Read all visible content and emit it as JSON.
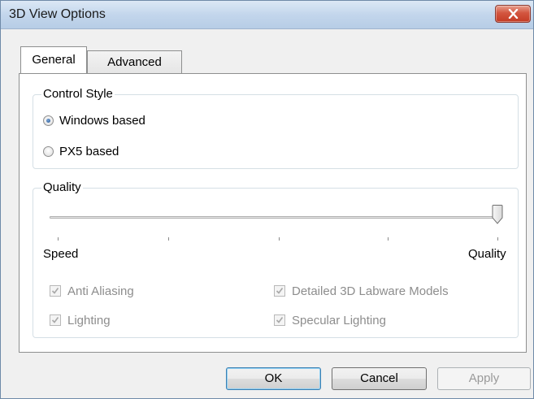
{
  "window": {
    "title": "3D View Options"
  },
  "tabs": [
    {
      "label": "General",
      "selected": true
    },
    {
      "label": "Advanced",
      "selected": false
    }
  ],
  "control_style": {
    "legend": "Control Style",
    "options": [
      {
        "label": "Windows based",
        "selected": true
      },
      {
        "label": "PX5 based",
        "selected": false
      }
    ]
  },
  "quality": {
    "legend": "Quality",
    "slider": {
      "min_label": "Speed",
      "max_label": "Quality",
      "value_fraction": 1.0,
      "tick_count": 5
    },
    "checkboxes": [
      {
        "label": "Anti Aliasing",
        "checked": true,
        "enabled": false
      },
      {
        "label": "Detailed 3D Labware Models",
        "checked": true,
        "enabled": false
      },
      {
        "label": "Lighting",
        "checked": true,
        "enabled": false
      },
      {
        "label": "Specular Lighting",
        "checked": true,
        "enabled": false
      }
    ]
  },
  "buttons": {
    "ok": "OK",
    "cancel": "Cancel",
    "apply": "Apply"
  },
  "icons": {
    "close": "close-icon"
  },
  "colors": {
    "close_button": "#c43b24",
    "title_bar": "#c3d6ec",
    "disabled_text": "#8d8d8d"
  }
}
